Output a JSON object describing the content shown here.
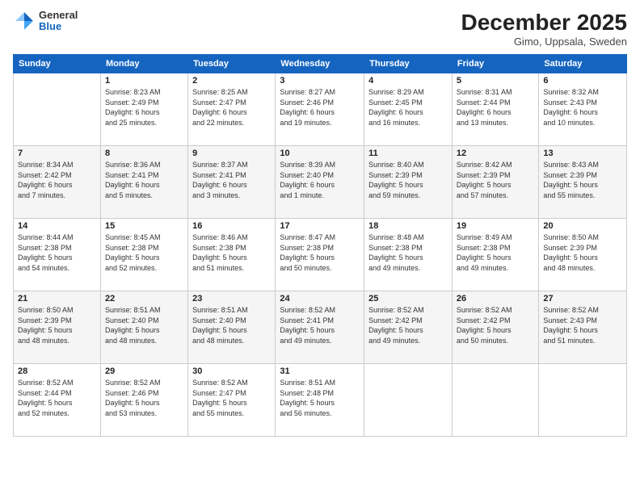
{
  "header": {
    "logo_general": "General",
    "logo_blue": "Blue",
    "title": "December 2025",
    "subtitle": "Gimo, Uppsala, Sweden"
  },
  "calendar": {
    "columns": [
      "Sunday",
      "Monday",
      "Tuesday",
      "Wednesday",
      "Thursday",
      "Friday",
      "Saturday"
    ],
    "rows": [
      [
        {
          "day": "",
          "detail": ""
        },
        {
          "day": "1",
          "detail": "Sunrise: 8:23 AM\nSunset: 2:49 PM\nDaylight: 6 hours\nand 25 minutes."
        },
        {
          "day": "2",
          "detail": "Sunrise: 8:25 AM\nSunset: 2:47 PM\nDaylight: 6 hours\nand 22 minutes."
        },
        {
          "day": "3",
          "detail": "Sunrise: 8:27 AM\nSunset: 2:46 PM\nDaylight: 6 hours\nand 19 minutes."
        },
        {
          "day": "4",
          "detail": "Sunrise: 8:29 AM\nSunset: 2:45 PM\nDaylight: 6 hours\nand 16 minutes."
        },
        {
          "day": "5",
          "detail": "Sunrise: 8:31 AM\nSunset: 2:44 PM\nDaylight: 6 hours\nand 13 minutes."
        },
        {
          "day": "6",
          "detail": "Sunrise: 8:32 AM\nSunset: 2:43 PM\nDaylight: 6 hours\nand 10 minutes."
        }
      ],
      [
        {
          "day": "7",
          "detail": "Sunrise: 8:34 AM\nSunset: 2:42 PM\nDaylight: 6 hours\nand 7 minutes."
        },
        {
          "day": "8",
          "detail": "Sunrise: 8:36 AM\nSunset: 2:41 PM\nDaylight: 6 hours\nand 5 minutes."
        },
        {
          "day": "9",
          "detail": "Sunrise: 8:37 AM\nSunset: 2:41 PM\nDaylight: 6 hours\nand 3 minutes."
        },
        {
          "day": "10",
          "detail": "Sunrise: 8:39 AM\nSunset: 2:40 PM\nDaylight: 6 hours\nand 1 minute."
        },
        {
          "day": "11",
          "detail": "Sunrise: 8:40 AM\nSunset: 2:39 PM\nDaylight: 5 hours\nand 59 minutes."
        },
        {
          "day": "12",
          "detail": "Sunrise: 8:42 AM\nSunset: 2:39 PM\nDaylight: 5 hours\nand 57 minutes."
        },
        {
          "day": "13",
          "detail": "Sunrise: 8:43 AM\nSunset: 2:39 PM\nDaylight: 5 hours\nand 55 minutes."
        }
      ],
      [
        {
          "day": "14",
          "detail": "Sunrise: 8:44 AM\nSunset: 2:38 PM\nDaylight: 5 hours\nand 54 minutes."
        },
        {
          "day": "15",
          "detail": "Sunrise: 8:45 AM\nSunset: 2:38 PM\nDaylight: 5 hours\nand 52 minutes."
        },
        {
          "day": "16",
          "detail": "Sunrise: 8:46 AM\nSunset: 2:38 PM\nDaylight: 5 hours\nand 51 minutes."
        },
        {
          "day": "17",
          "detail": "Sunrise: 8:47 AM\nSunset: 2:38 PM\nDaylight: 5 hours\nand 50 minutes."
        },
        {
          "day": "18",
          "detail": "Sunrise: 8:48 AM\nSunset: 2:38 PM\nDaylight: 5 hours\nand 49 minutes."
        },
        {
          "day": "19",
          "detail": "Sunrise: 8:49 AM\nSunset: 2:38 PM\nDaylight: 5 hours\nand 49 minutes."
        },
        {
          "day": "20",
          "detail": "Sunrise: 8:50 AM\nSunset: 2:39 PM\nDaylight: 5 hours\nand 48 minutes."
        }
      ],
      [
        {
          "day": "21",
          "detail": "Sunrise: 8:50 AM\nSunset: 2:39 PM\nDaylight: 5 hours\nand 48 minutes."
        },
        {
          "day": "22",
          "detail": "Sunrise: 8:51 AM\nSunset: 2:40 PM\nDaylight: 5 hours\nand 48 minutes."
        },
        {
          "day": "23",
          "detail": "Sunrise: 8:51 AM\nSunset: 2:40 PM\nDaylight: 5 hours\nand 48 minutes."
        },
        {
          "day": "24",
          "detail": "Sunrise: 8:52 AM\nSunset: 2:41 PM\nDaylight: 5 hours\nand 49 minutes."
        },
        {
          "day": "25",
          "detail": "Sunrise: 8:52 AM\nSunset: 2:42 PM\nDaylight: 5 hours\nand 49 minutes."
        },
        {
          "day": "26",
          "detail": "Sunrise: 8:52 AM\nSunset: 2:42 PM\nDaylight: 5 hours\nand 50 minutes."
        },
        {
          "day": "27",
          "detail": "Sunrise: 8:52 AM\nSunset: 2:43 PM\nDaylight: 5 hours\nand 51 minutes."
        }
      ],
      [
        {
          "day": "28",
          "detail": "Sunrise: 8:52 AM\nSunset: 2:44 PM\nDaylight: 5 hours\nand 52 minutes."
        },
        {
          "day": "29",
          "detail": "Sunrise: 8:52 AM\nSunset: 2:46 PM\nDaylight: 5 hours\nand 53 minutes."
        },
        {
          "day": "30",
          "detail": "Sunrise: 8:52 AM\nSunset: 2:47 PM\nDaylight: 5 hours\nand 55 minutes."
        },
        {
          "day": "31",
          "detail": "Sunrise: 8:51 AM\nSunset: 2:48 PM\nDaylight: 5 hours\nand 56 minutes."
        },
        {
          "day": "",
          "detail": ""
        },
        {
          "day": "",
          "detail": ""
        },
        {
          "day": "",
          "detail": ""
        }
      ]
    ]
  }
}
